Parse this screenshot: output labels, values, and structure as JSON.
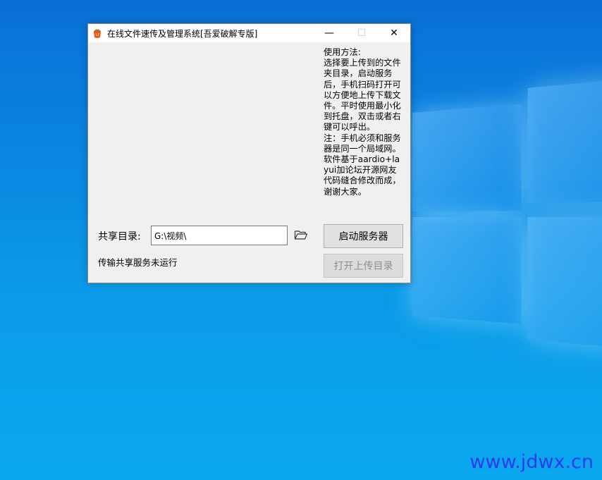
{
  "window": {
    "title": "在线文件速传及管理系统[吾爱破解专版]",
    "minimize_glyph": "—",
    "maximize_glyph": "☐",
    "close_glyph": "✕"
  },
  "help": {
    "text": "使用方法:\n选择要上传到的文件夹目录，启动服务后，手机扫码打开可以方便地上传下载文件。平时使用最小化到托盘，双击或者右键可以呼出。\n注：手机必须和服务器是同一个局域网。软件基于aardio+layui加论坛开源网友代码缝合修改而成，谢谢大家。"
  },
  "share": {
    "label": "共享目录:",
    "path": "G:\\视频\\"
  },
  "buttons": {
    "start": "启动服务器",
    "open_upload": "打开上传目录"
  },
  "status": {
    "text": "传输共享服务未运行"
  },
  "desktop": {
    "watermark": "www.jdwx.cn"
  },
  "icons": {
    "app": "app-logo-icon",
    "folder": "folder-open-icon"
  }
}
